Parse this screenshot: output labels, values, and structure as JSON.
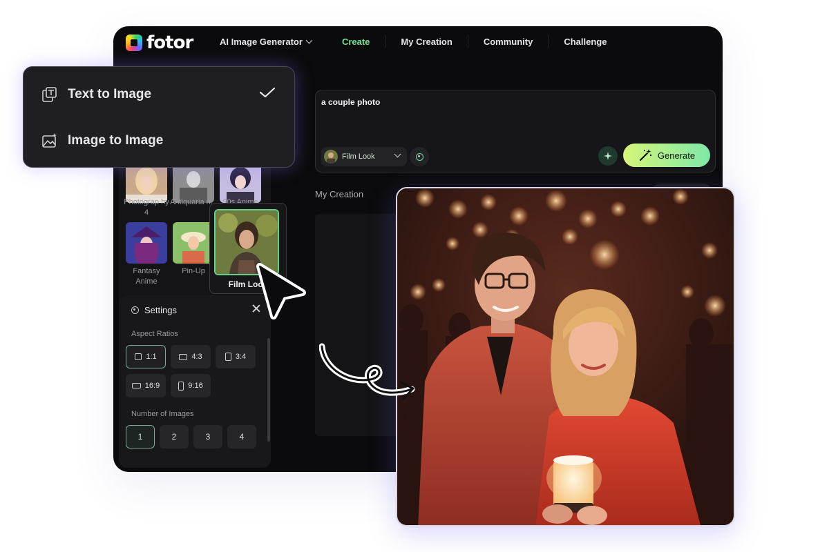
{
  "brand": {
    "name": "fotor"
  },
  "nav": {
    "generator": "AI Image Generator",
    "create": "Create",
    "my_creation": "My Creation",
    "community": "Community",
    "challenge": "Challenge"
  },
  "mode_menu": {
    "items": [
      {
        "label": "Text to Image",
        "selected": true
      },
      {
        "label": "Image to Image",
        "selected": false
      }
    ]
  },
  "styles": {
    "items": [
      {
        "label": "Photograp hy 4"
      },
      {
        "label": "Antiquaria n..."
      },
      {
        "label": "90s Anime"
      },
      {
        "label": "Fantasy Anime"
      },
      {
        "label": "Pin-Up"
      },
      {
        "label": "Film Look"
      }
    ],
    "selected": "Film Look"
  },
  "settings": {
    "title": "Settings",
    "aspect_label": "Aspect Ratios",
    "aspect_ratios": [
      "1:1",
      "4:3",
      "3:4",
      "16:9",
      "9:16"
    ],
    "aspect_selected": "1:1",
    "count_label": "Number of Images",
    "counts": [
      "1",
      "2",
      "3",
      "4"
    ],
    "count_selected": "1"
  },
  "prompt": {
    "value": "a  couple photo",
    "style_chip": "Film Look",
    "generate_label": "Generate"
  },
  "main": {
    "section_title": "My Creation"
  },
  "colors": {
    "accent_green": "#6ee58e",
    "generate_gradient_start": "#d7f57a",
    "generate_gradient_end": "#7ee8a7",
    "app_bg": "#0b0b0d"
  }
}
